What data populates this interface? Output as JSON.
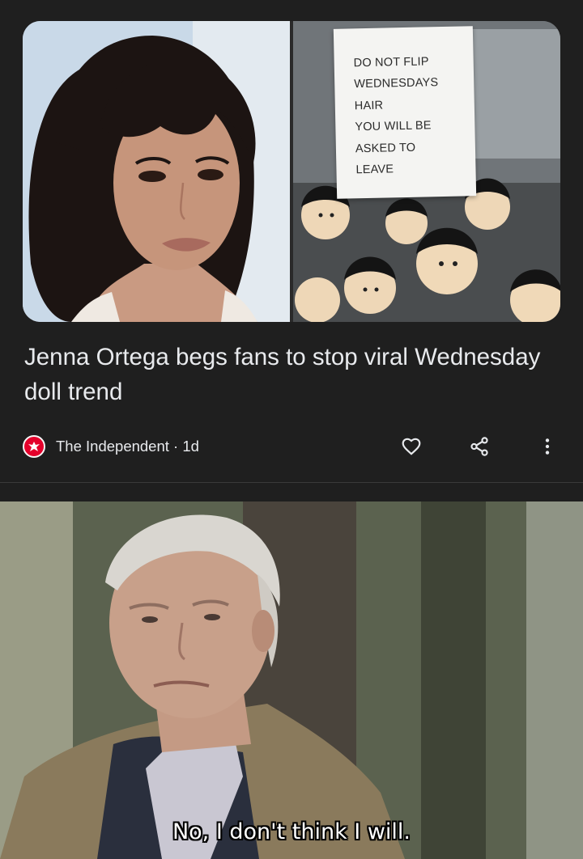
{
  "article": {
    "headline": "Jenna Ortega begs fans to stop viral Wednesday doll trend",
    "publisher": "The Independent",
    "age": "1d",
    "publisher_line": "The Independent · 1d",
    "sign_lines": [
      "DO NOT FLIP",
      "WEDNESDAYS",
      "HAIR",
      "YOU WILL BE",
      "ASKED TO",
      "LEAVE"
    ],
    "icons": {
      "like": "heart-icon",
      "share": "share-icon",
      "more": "more-vert-icon",
      "publisher": "eagle-icon"
    }
  },
  "meme": {
    "caption": "No, I don't think I will."
  },
  "colors": {
    "background": "#1f1f1f",
    "text": "#e8eaed",
    "publisher_red": "#e4002b"
  }
}
